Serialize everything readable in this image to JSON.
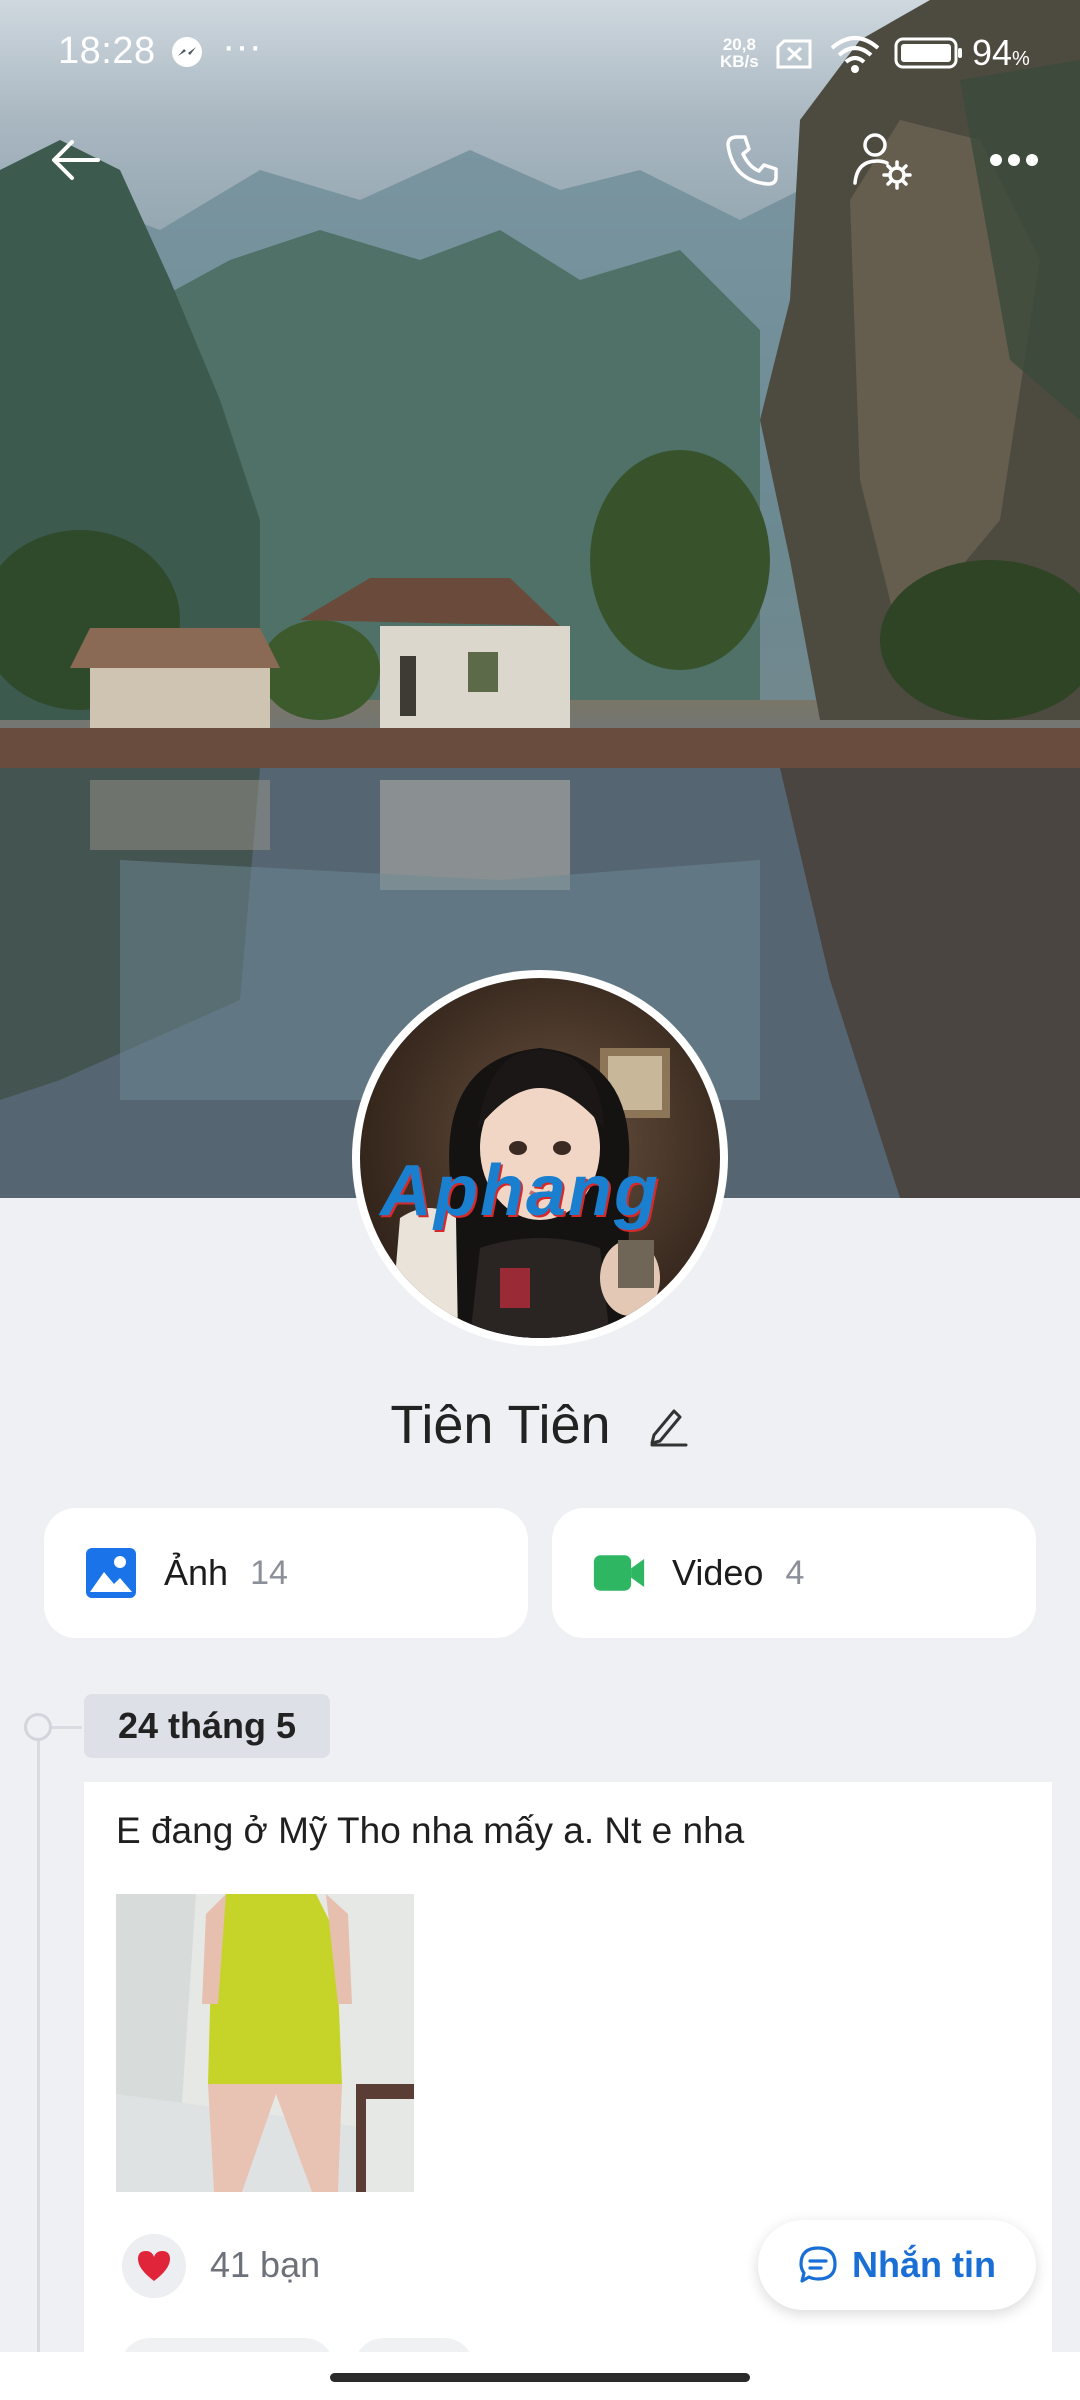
{
  "status_bar": {
    "time": "18:28",
    "more": "···",
    "net_speed_value": "20,8",
    "net_speed_unit": "KB/s",
    "battery_percent": "94",
    "battery_unit": "%"
  },
  "profile": {
    "name": "Tiên Tiên",
    "watermark": "Aphang"
  },
  "media": {
    "photos_label": "Ảnh",
    "photos_count": "14",
    "videos_label": "Video",
    "videos_count": "4"
  },
  "timeline": {
    "date": "24 tháng 5"
  },
  "post": {
    "text": "E đang ở Mỹ Tho nha mấy a. Nt e nha",
    "likes": "41 bạn"
  },
  "actions": {
    "message_label": "Nhắn tin"
  },
  "colors": {
    "accent": "#1a6fd6",
    "photo_icon": "#1a73e8",
    "video_icon": "#2eb663",
    "like": "#e0243a"
  }
}
